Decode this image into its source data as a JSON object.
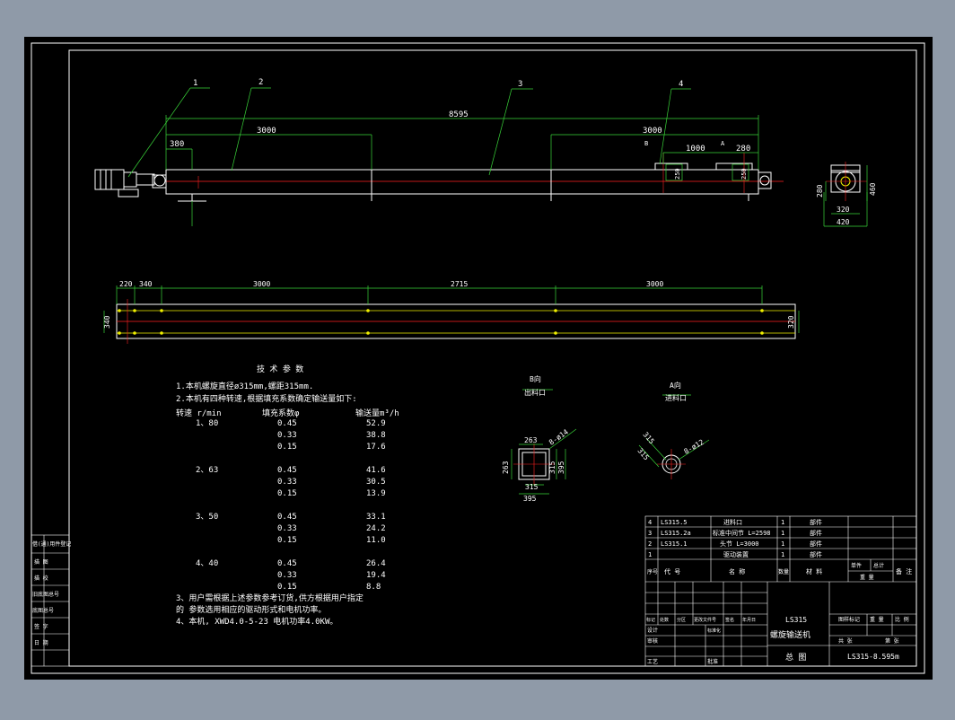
{
  "colors": {
    "window_bg": "#8f9aa8",
    "sheet": "#000000",
    "frame": "#ffffff",
    "dimension": "#39d439",
    "text": "#ffffff",
    "yellow": "#f0f000",
    "red": "#ff2020",
    "cyan": "#00d8ff"
  },
  "balloons": [
    "1",
    "2",
    "3",
    "4"
  ],
  "elevation_dims": {
    "overall": "8595",
    "left_section": "3000",
    "right_section": "3000",
    "left_offset": "380",
    "inlet_spacing": "1000",
    "right_offset": "280",
    "label_b": "B",
    "label_a": "A",
    "outlet_size": "250",
    "inlet_size": "250"
  },
  "end_view_dims": {
    "height": "280",
    "inner_width": "320",
    "outer_width": "420",
    "total_height": "460"
  },
  "plan_dims": {
    "d220": "220",
    "d340": "340",
    "s1": "3000",
    "s2": "2715",
    "s3": "3000",
    "left_width": "340",
    "right_width": "320"
  },
  "tech": {
    "title": "技 术 参 数",
    "line1": "1.本机螺旋直径ø315mm,螺距315mm.",
    "line2": "2.本机有四种转速,根据填充系数确定输送量如下:",
    "headers": [
      "转速 r/min",
      "填充系数φ",
      "输送量m³/h"
    ],
    "groups": [
      {
        "speed": "1、80",
        "rows": [
          [
            "0.45",
            "52.9"
          ],
          [
            "0.33",
            "38.8"
          ],
          [
            "0.15",
            "17.6"
          ]
        ]
      },
      {
        "speed": "2、63",
        "rows": [
          [
            "0.45",
            "41.6"
          ],
          [
            "0.33",
            "30.5"
          ],
          [
            "0.15",
            "13.9"
          ]
        ]
      },
      {
        "speed": "3、50",
        "rows": [
          [
            "0.45",
            "33.1"
          ],
          [
            "0.33",
            "24.2"
          ],
          [
            "0.15",
            "11.0"
          ]
        ]
      },
      {
        "speed": "4、40",
        "rows": [
          [
            "0.45",
            "26.4"
          ],
          [
            "0.33",
            "19.4"
          ],
          [
            "0.15",
            "8.8"
          ]
        ]
      }
    ],
    "note3a": "3、用户需根据上述参数参考订货,供方根据用户指定",
    "note3b": "的 参数选用相应的驱动形式和电机功率。",
    "note4": "4、本机, XWD4.0-5-23 电机功率4.0KW。"
  },
  "outlet_view": {
    "view_label": "B向",
    "name": "出料口",
    "d_top": "263",
    "d_left": "263",
    "d_inner": "315",
    "d_right": "395",
    "d_bottom": "395",
    "holes": "8-ø14"
  },
  "inlet_view": {
    "view_label": "A向",
    "name": "进料口",
    "d_a": "315",
    "d_b": "315",
    "holes": "8-ø12"
  },
  "title_block": {
    "parts": [
      {
        "no": "4",
        "code": "LS315.5",
        "name": "进料口",
        "qty": "1",
        "material": "",
        "note": "部件"
      },
      {
        "no": "3",
        "code": "LS315.2a",
        "name": "标准中间节 L=2598",
        "qty": "1",
        "material": "",
        "note": "部件"
      },
      {
        "no": "2",
        "code": "LS315.1",
        "name": "头节 L=3000",
        "qty": "1",
        "material": "",
        "note": "部件"
      },
      {
        "no": "1",
        "code": "",
        "name": "驱动装置",
        "qty": "1",
        "material": "",
        "note": "部件"
      }
    ],
    "header": {
      "no": "序号",
      "code": "代 号",
      "name": "名 称",
      "qty": "数量",
      "material": "材 料",
      "unit": "单件",
      "total": "总计",
      "weight": "重 量",
      "note": "备 注"
    },
    "sign_row": [
      "标记",
      "处数",
      "分区",
      "更改文件号",
      "签名",
      "年月日"
    ],
    "row_design": "设计",
    "row_std": "标准化",
    "row_review": "审核",
    "row_process": "工艺",
    "row_approve": "批准",
    "model": "LS315",
    "product": "螺旋输送机",
    "drawing": "总 图",
    "stage_label": "图样标记",
    "weight_label": "重 量",
    "scale_label": "比 例",
    "sheet_total": "共 张",
    "sheet_no": "第 张",
    "dwg_no": "LS315-8.595m"
  },
  "side_labels": [
    "借(通)用件登记",
    "描 图",
    "描 校",
    "旧底图总号",
    "底图总号",
    "签 字",
    "日 期"
  ]
}
